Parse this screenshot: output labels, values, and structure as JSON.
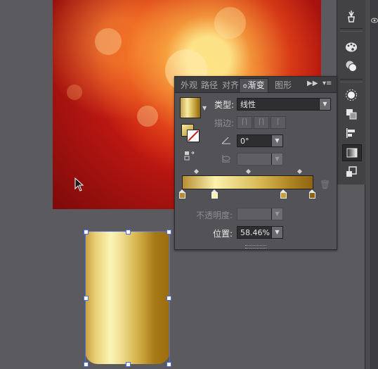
{
  "panel": {
    "tabs": [
      "外观",
      "路径",
      "对齐",
      "渐变",
      "图形"
    ],
    "active_tab": "渐变",
    "type_label": "类型:",
    "type_value": "线性",
    "stroke_label": "描边:",
    "angle_value": "0°",
    "opacity_label": "不透明度:",
    "opacity_value": "",
    "position_label": "位置:",
    "position_value": "58.46%"
  },
  "gradient": {
    "stops": [
      {
        "location": 0,
        "color": "#b78d35"
      },
      {
        "location": 0.25,
        "color": "#fbf2ac"
      },
      {
        "location": 0.78,
        "color": "#c4a03a"
      },
      {
        "location": 1.0,
        "color": "#8e6410"
      }
    ],
    "accent_selected": "#d8d8d8"
  },
  "toolstrip": {
    "icons": [
      "brush-icon",
      "palette-icon",
      "color-guide-icon",
      "sun-icon",
      "pathfinder-icon",
      "align-icon",
      "gradient-icon",
      "transform-icon"
    ],
    "active_icon": "gradient-icon"
  },
  "colors": {
    "selection": "#4c6de2",
    "ui_background": "#5b5a5f"
  }
}
